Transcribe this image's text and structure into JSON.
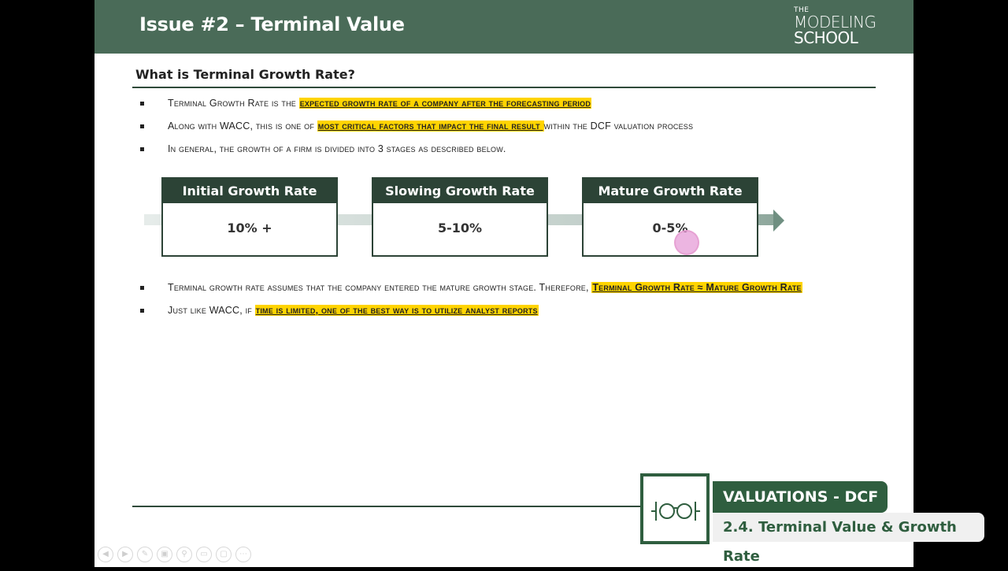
{
  "header": {
    "title": "Issue #2 – Terminal Value",
    "logo": {
      "line1": "THE",
      "line2": "MODELING",
      "line3": "SCHOOL"
    }
  },
  "section": {
    "title": "What is Terminal Growth Rate?"
  },
  "bullets_top": [
    {
      "pre": "Terminal Growth Rate is the ",
      "highlight": "expected growth rate of a company after the forecasting period",
      "post": ""
    },
    {
      "pre": "Along with WACC, this is one of ",
      "highlight": "most critical factors that impact the final result ",
      "post": "within the DCF valuation process"
    },
    {
      "pre": "In general, the growth of a firm is divided into 3 stages as described below.",
      "highlight": "",
      "post": ""
    }
  ],
  "stages": [
    {
      "title": "Initial Growth Rate",
      "value": "10% +"
    },
    {
      "title": "Slowing Growth Rate",
      "value": "5-10%"
    },
    {
      "title": "Mature Growth Rate",
      "value": "0-5%"
    }
  ],
  "bullets_bottom": [
    {
      "pre": "Terminal growth rate assumes that the company entered the mature growth stage. Therefore, ",
      "highlight": "Terminal Growth Rate ≈ Mature Growth Rate",
      "post": ""
    },
    {
      "pre": "Just like WACC, if ",
      "highlight": "time is limited, one of the best way is to utilize analyst reports",
      "post": ""
    }
  ],
  "badge": {
    "course": "VALUATIONS - DCF",
    "lesson": "2.4. Terminal Value & Growth Rate"
  },
  "toolbar": {
    "buttons": [
      "prev-icon",
      "next-icon",
      "pen-icon",
      "slides-icon",
      "zoom-icon",
      "subtitles-icon",
      "camera-icon",
      "more-icon"
    ],
    "glyphs": [
      "◀",
      "▶",
      "✎",
      "▣",
      "⚲",
      "▭",
      "▢",
      "⋯"
    ]
  },
  "colors": {
    "header_bg": "#4a6b58",
    "stage_dark": "#2c4336",
    "highlight": "#ffd400",
    "badge_green": "#2f5e3f"
  }
}
